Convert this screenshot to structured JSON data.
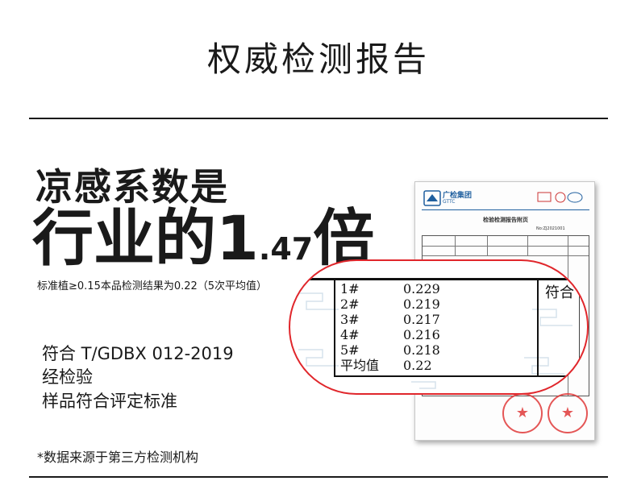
{
  "title": "权威检测报告",
  "headline": {
    "line1": "凉感系数是",
    "line2_main": "行业的1",
    "line2_small": ".47",
    "line2_suffix": "倍"
  },
  "note": "标准植≥0.15本品检测结果为0.22（5次平均值）",
  "standard": {
    "line1": "符合 T/GDBX 012-2019",
    "line2": "经检验",
    "line3": "样品符合评定标准"
  },
  "footnote": "*数据来源于第三方检测机构",
  "report": {
    "logo": "广检集团",
    "logo_sub": "GTTC",
    "title": "检验检测报告附页",
    "number": "No:ZJ2021001",
    "results": [
      {
        "sample": "1#",
        "value": "0.229"
      },
      {
        "sample": "2#",
        "value": "0.219"
      },
      {
        "sample": "3#",
        "value": "0.217"
      },
      {
        "sample": "4#",
        "value": "0.216"
      },
      {
        "sample": "5#",
        "value": "0.218"
      },
      {
        "sample": "平均值",
        "value": "0.22"
      }
    ],
    "verdict": "符合"
  },
  "colors": {
    "accent_red": "#e0262b",
    "report_blue": "#1f5f9f",
    "seal_red": "#e03a3a"
  }
}
